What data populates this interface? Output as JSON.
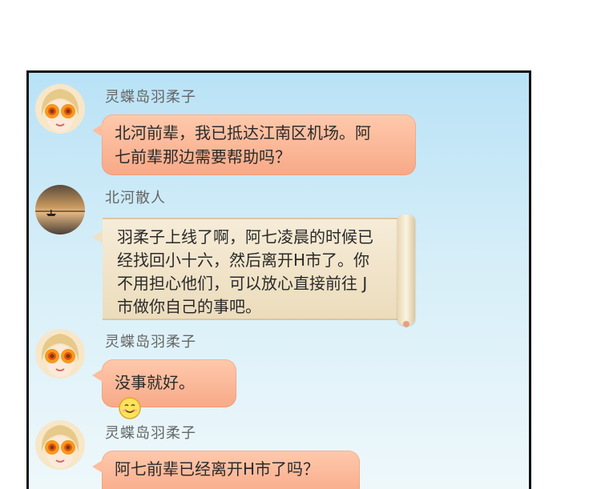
{
  "messages": [
    {
      "sender": "灵蝶岛羽柔子",
      "avatar": "sunflower-eyes-avatar",
      "text_lines": [
        "北河前辈，我已抵达江南区机场。阿",
        "七前辈那边需要帮助吗？"
      ]
    },
    {
      "sender": "北河散人",
      "avatar": "sunset-lake-avatar",
      "text_lines": [
        "羽柔子上线了啊，阿七凌晨的时候已",
        "经找回小十六，然后离开H市了。你",
        "不用担心他们，可以放心直接前往 J",
        "市做你自己的事吧。"
      ]
    },
    {
      "sender": "灵蝶岛羽柔子",
      "avatar": "sunflower-eyes-avatar",
      "text_lines": [
        "没事就好。"
      ],
      "emoji": "smiley-face-icon"
    },
    {
      "sender": "灵蝶岛羽柔子",
      "avatar": "sunflower-eyes-avatar",
      "text_lines": [
        "阿七前辈已经离开H市了吗？"
      ]
    }
  ],
  "colors": {
    "bubble": "#f7a987",
    "scroll": "#f2e6cc",
    "panel_top": "#b9e2f6",
    "border": "#111111"
  }
}
